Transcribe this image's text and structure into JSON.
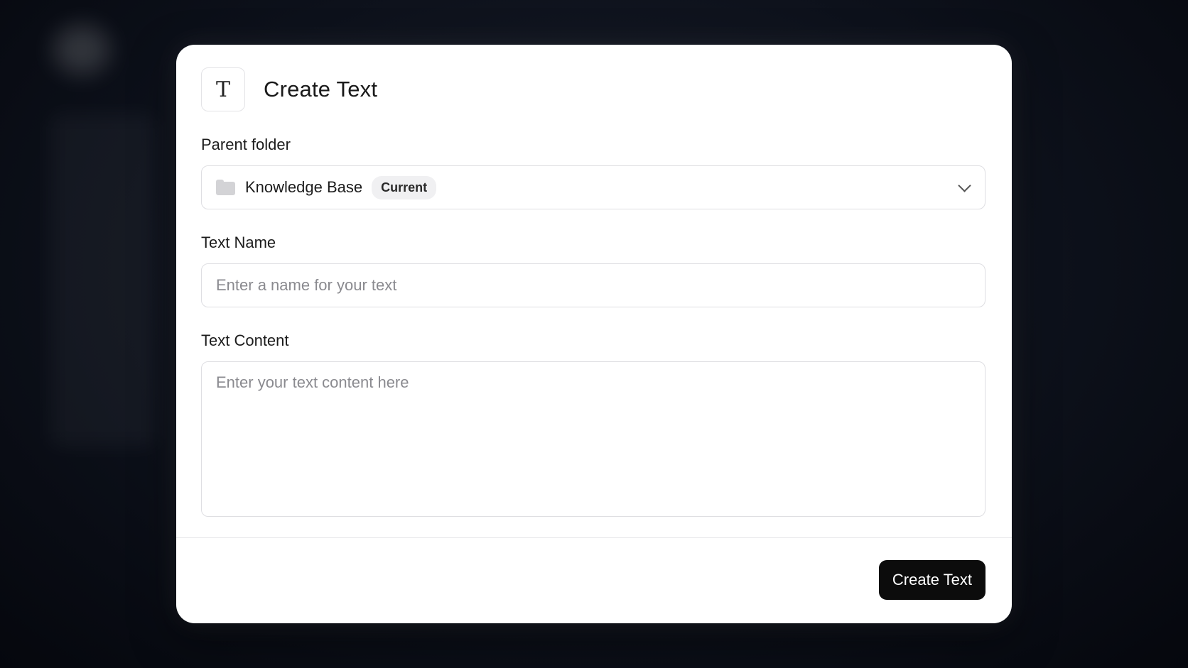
{
  "dialog": {
    "title": "Create Text",
    "icon": "text-type-icon",
    "icon_glyph": "T"
  },
  "parent_folder": {
    "label": "Parent folder",
    "icon": "folder-icon",
    "selected_value": "Knowledge Base",
    "badge": "Current",
    "dropdown_icon": "chevron-down-icon"
  },
  "text_name": {
    "label": "Text Name",
    "value": "",
    "placeholder": "Enter a name for your text"
  },
  "text_content": {
    "label": "Text Content",
    "value": "",
    "placeholder": "Enter your text content here"
  },
  "footer": {
    "submit_label": "Create Text"
  },
  "colors": {
    "primary_button": "#0c0c0c",
    "backdrop": "#0d111b"
  }
}
